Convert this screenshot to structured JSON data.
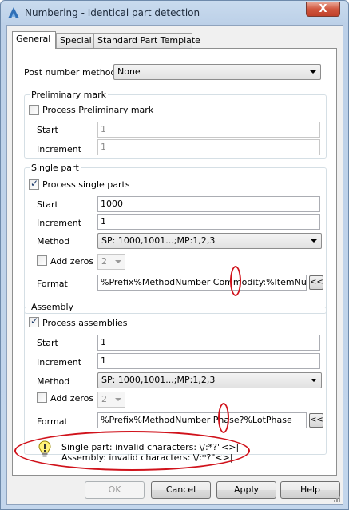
{
  "window": {
    "title": "Numbering - Identical part detection",
    "close_glyph": "X"
  },
  "tabs": [
    {
      "label": "General"
    },
    {
      "label": "Special"
    },
    {
      "label": "Standard Part Template"
    }
  ],
  "post_number": {
    "label": "Post number method",
    "value": "None"
  },
  "preliminary": {
    "group_title": "Preliminary mark",
    "process_label": "Process Preliminary mark",
    "start_label": "Start",
    "start_value": "1",
    "increment_label": "Increment",
    "increment_value": "1"
  },
  "single_part": {
    "group_title": "Single part",
    "process_label": "Process single parts",
    "start_label": "Start",
    "start_value": "1000",
    "increment_label": "Increment",
    "increment_value": "1",
    "method_label": "Method",
    "method_value": "SP: 1000,1001...;MP:1,2,3",
    "add_zeros_label": "Add zeros",
    "add_zeros_value": "2",
    "format_label": "Format",
    "format_value": "%Prefix%MethodNumber Commodity:%ItemNumber",
    "expand_label": "<<"
  },
  "assembly": {
    "group_title": "Assembly",
    "process_label": "Process assemblies",
    "start_label": "Start",
    "start_value": "1",
    "increment_label": "Increment",
    "increment_value": "1",
    "method_label": "Method",
    "method_value": "SP: 1000,1001...;MP:1,2,3",
    "add_zeros_label": "Add zeros",
    "add_zeros_value": "2",
    "format_label": "Format",
    "format_value": "%Prefix%MethodNumber Phase?%LotPhase",
    "expand_label": "<<"
  },
  "warning": {
    "line1": "Single part: invalid characters: \\/:*?\"<>|",
    "line2": "Assembly: invalid characters: \\/:*?\"<>|"
  },
  "buttons": {
    "ok": "OK",
    "cancel": "Cancel",
    "apply": "Apply",
    "help": "Help"
  },
  "colors": {
    "annotation_red": "#d0121b",
    "title_bar": "#c9dbee"
  }
}
